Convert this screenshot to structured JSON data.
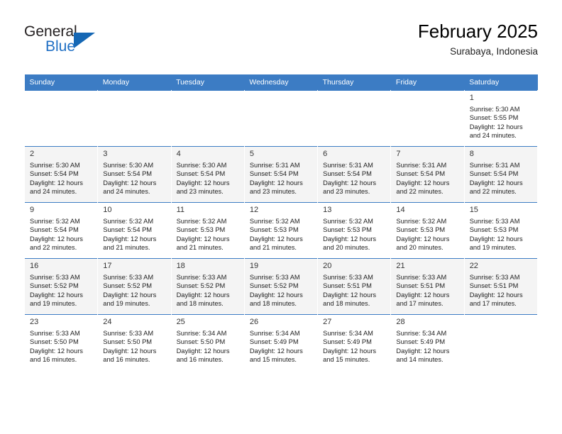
{
  "brand": {
    "name_part1": "General",
    "name_part2": "Blue",
    "logo_icon": "triangle-logo-icon",
    "accent_color": "#1567b4"
  },
  "header": {
    "title": "February 2025",
    "subtitle": "Surabaya, Indonesia"
  },
  "theme": {
    "header_row_bg": "#3c7cc4",
    "header_row_text": "#ffffff",
    "shaded_row_bg": "#f4f4f4",
    "cell_border": "#3c7cc4"
  },
  "weekday_headers": [
    "Sunday",
    "Monday",
    "Tuesday",
    "Wednesday",
    "Thursday",
    "Friday",
    "Saturday"
  ],
  "weeks": [
    {
      "shaded": false,
      "days": [
        {
          "empty": true,
          "date": "",
          "sunrise": "",
          "sunset": "",
          "daylight_line1": "",
          "daylight_line2": ""
        },
        {
          "empty": true,
          "date": "",
          "sunrise": "",
          "sunset": "",
          "daylight_line1": "",
          "daylight_line2": ""
        },
        {
          "empty": true,
          "date": "",
          "sunrise": "",
          "sunset": "",
          "daylight_line1": "",
          "daylight_line2": ""
        },
        {
          "empty": true,
          "date": "",
          "sunrise": "",
          "sunset": "",
          "daylight_line1": "",
          "daylight_line2": ""
        },
        {
          "empty": true,
          "date": "",
          "sunrise": "",
          "sunset": "",
          "daylight_line1": "",
          "daylight_line2": ""
        },
        {
          "empty": true,
          "date": "",
          "sunrise": "",
          "sunset": "",
          "daylight_line1": "",
          "daylight_line2": ""
        },
        {
          "empty": false,
          "date": "1",
          "sunrise": "Sunrise: 5:30 AM",
          "sunset": "Sunset: 5:55 PM",
          "daylight_line1": "Daylight: 12 hours",
          "daylight_line2": "and 24 minutes."
        }
      ]
    },
    {
      "shaded": true,
      "days": [
        {
          "empty": false,
          "date": "2",
          "sunrise": "Sunrise: 5:30 AM",
          "sunset": "Sunset: 5:54 PM",
          "daylight_line1": "Daylight: 12 hours",
          "daylight_line2": "and 24 minutes."
        },
        {
          "empty": false,
          "date": "3",
          "sunrise": "Sunrise: 5:30 AM",
          "sunset": "Sunset: 5:54 PM",
          "daylight_line1": "Daylight: 12 hours",
          "daylight_line2": "and 24 minutes."
        },
        {
          "empty": false,
          "date": "4",
          "sunrise": "Sunrise: 5:30 AM",
          "sunset": "Sunset: 5:54 PM",
          "daylight_line1": "Daylight: 12 hours",
          "daylight_line2": "and 23 minutes."
        },
        {
          "empty": false,
          "date": "5",
          "sunrise": "Sunrise: 5:31 AM",
          "sunset": "Sunset: 5:54 PM",
          "daylight_line1": "Daylight: 12 hours",
          "daylight_line2": "and 23 minutes."
        },
        {
          "empty": false,
          "date": "6",
          "sunrise": "Sunrise: 5:31 AM",
          "sunset": "Sunset: 5:54 PM",
          "daylight_line1": "Daylight: 12 hours",
          "daylight_line2": "and 23 minutes."
        },
        {
          "empty": false,
          "date": "7",
          "sunrise": "Sunrise: 5:31 AM",
          "sunset": "Sunset: 5:54 PM",
          "daylight_line1": "Daylight: 12 hours",
          "daylight_line2": "and 22 minutes."
        },
        {
          "empty": false,
          "date": "8",
          "sunrise": "Sunrise: 5:31 AM",
          "sunset": "Sunset: 5:54 PM",
          "daylight_line1": "Daylight: 12 hours",
          "daylight_line2": "and 22 minutes."
        }
      ]
    },
    {
      "shaded": false,
      "days": [
        {
          "empty": false,
          "date": "9",
          "sunrise": "Sunrise: 5:32 AM",
          "sunset": "Sunset: 5:54 PM",
          "daylight_line1": "Daylight: 12 hours",
          "daylight_line2": "and 22 minutes."
        },
        {
          "empty": false,
          "date": "10",
          "sunrise": "Sunrise: 5:32 AM",
          "sunset": "Sunset: 5:54 PM",
          "daylight_line1": "Daylight: 12 hours",
          "daylight_line2": "and 21 minutes."
        },
        {
          "empty": false,
          "date": "11",
          "sunrise": "Sunrise: 5:32 AM",
          "sunset": "Sunset: 5:53 PM",
          "daylight_line1": "Daylight: 12 hours",
          "daylight_line2": "and 21 minutes."
        },
        {
          "empty": false,
          "date": "12",
          "sunrise": "Sunrise: 5:32 AM",
          "sunset": "Sunset: 5:53 PM",
          "daylight_line1": "Daylight: 12 hours",
          "daylight_line2": "and 21 minutes."
        },
        {
          "empty": false,
          "date": "13",
          "sunrise": "Sunrise: 5:32 AM",
          "sunset": "Sunset: 5:53 PM",
          "daylight_line1": "Daylight: 12 hours",
          "daylight_line2": "and 20 minutes."
        },
        {
          "empty": false,
          "date": "14",
          "sunrise": "Sunrise: 5:32 AM",
          "sunset": "Sunset: 5:53 PM",
          "daylight_line1": "Daylight: 12 hours",
          "daylight_line2": "and 20 minutes."
        },
        {
          "empty": false,
          "date": "15",
          "sunrise": "Sunrise: 5:33 AM",
          "sunset": "Sunset: 5:53 PM",
          "daylight_line1": "Daylight: 12 hours",
          "daylight_line2": "and 19 minutes."
        }
      ]
    },
    {
      "shaded": true,
      "days": [
        {
          "empty": false,
          "date": "16",
          "sunrise": "Sunrise: 5:33 AM",
          "sunset": "Sunset: 5:52 PM",
          "daylight_line1": "Daylight: 12 hours",
          "daylight_line2": "and 19 minutes."
        },
        {
          "empty": false,
          "date": "17",
          "sunrise": "Sunrise: 5:33 AM",
          "sunset": "Sunset: 5:52 PM",
          "daylight_line1": "Daylight: 12 hours",
          "daylight_line2": "and 19 minutes."
        },
        {
          "empty": false,
          "date": "18",
          "sunrise": "Sunrise: 5:33 AM",
          "sunset": "Sunset: 5:52 PM",
          "daylight_line1": "Daylight: 12 hours",
          "daylight_line2": "and 18 minutes."
        },
        {
          "empty": false,
          "date": "19",
          "sunrise": "Sunrise: 5:33 AM",
          "sunset": "Sunset: 5:52 PM",
          "daylight_line1": "Daylight: 12 hours",
          "daylight_line2": "and 18 minutes."
        },
        {
          "empty": false,
          "date": "20",
          "sunrise": "Sunrise: 5:33 AM",
          "sunset": "Sunset: 5:51 PM",
          "daylight_line1": "Daylight: 12 hours",
          "daylight_line2": "and 18 minutes."
        },
        {
          "empty": false,
          "date": "21",
          "sunrise": "Sunrise: 5:33 AM",
          "sunset": "Sunset: 5:51 PM",
          "daylight_line1": "Daylight: 12 hours",
          "daylight_line2": "and 17 minutes."
        },
        {
          "empty": false,
          "date": "22",
          "sunrise": "Sunrise: 5:33 AM",
          "sunset": "Sunset: 5:51 PM",
          "daylight_line1": "Daylight: 12 hours",
          "daylight_line2": "and 17 minutes."
        }
      ]
    },
    {
      "shaded": false,
      "days": [
        {
          "empty": false,
          "date": "23",
          "sunrise": "Sunrise: 5:33 AM",
          "sunset": "Sunset: 5:50 PM",
          "daylight_line1": "Daylight: 12 hours",
          "daylight_line2": "and 16 minutes."
        },
        {
          "empty": false,
          "date": "24",
          "sunrise": "Sunrise: 5:33 AM",
          "sunset": "Sunset: 5:50 PM",
          "daylight_line1": "Daylight: 12 hours",
          "daylight_line2": "and 16 minutes."
        },
        {
          "empty": false,
          "date": "25",
          "sunrise": "Sunrise: 5:34 AM",
          "sunset": "Sunset: 5:50 PM",
          "daylight_line1": "Daylight: 12 hours",
          "daylight_line2": "and 16 minutes."
        },
        {
          "empty": false,
          "date": "26",
          "sunrise": "Sunrise: 5:34 AM",
          "sunset": "Sunset: 5:49 PM",
          "daylight_line1": "Daylight: 12 hours",
          "daylight_line2": "and 15 minutes."
        },
        {
          "empty": false,
          "date": "27",
          "sunrise": "Sunrise: 5:34 AM",
          "sunset": "Sunset: 5:49 PM",
          "daylight_line1": "Daylight: 12 hours",
          "daylight_line2": "and 15 minutes."
        },
        {
          "empty": false,
          "date": "28",
          "sunrise": "Sunrise: 5:34 AM",
          "sunset": "Sunset: 5:49 PM",
          "daylight_line1": "Daylight: 12 hours",
          "daylight_line2": "and 14 minutes."
        },
        {
          "empty": true,
          "date": "",
          "sunrise": "",
          "sunset": "",
          "daylight_line1": "",
          "daylight_line2": ""
        }
      ]
    }
  ]
}
